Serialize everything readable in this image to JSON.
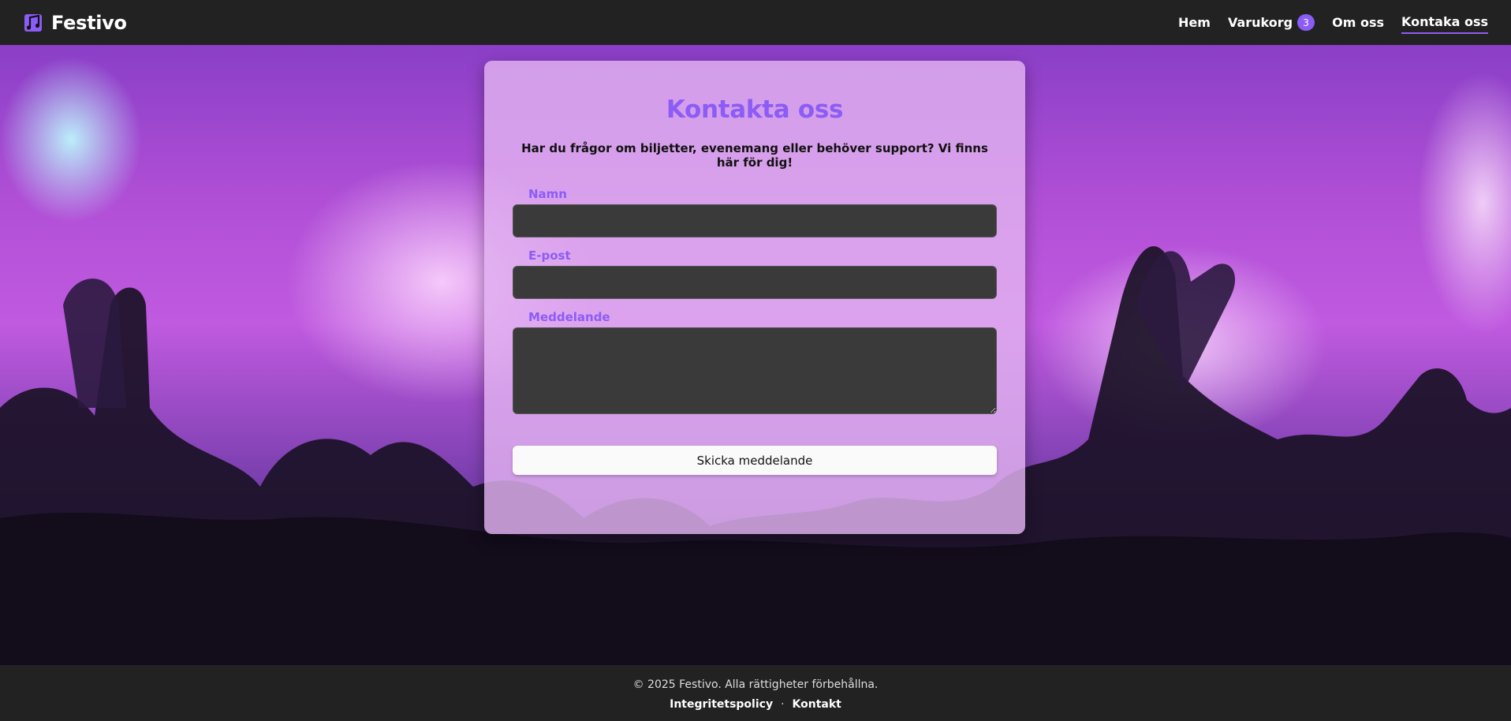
{
  "header": {
    "brand": "Festivo",
    "brand_icon": "music-notes-icon",
    "accent_color": "#8b5cf6",
    "nav": {
      "home": "Hem",
      "cart": "Varukorg",
      "cart_count": "3",
      "about": "Om oss",
      "contact": "Kontaka oss"
    }
  },
  "contact_form": {
    "title": "Kontakta oss",
    "intro": "Har du frågor om biljetter, evenemang eller behöver support? Vi finns här för dig!",
    "name_label": "Namn",
    "name_value": "",
    "email_label": "E-post",
    "email_value": "",
    "message_label": "Meddelande",
    "message_value": "",
    "submit_label": "Skicka meddelande"
  },
  "footer": {
    "copyright": "© 2025 Festivo. Alla rättigheter förbehållna.",
    "privacy": "Integritetspolicy",
    "separator": "·",
    "contact": "Kontakt"
  }
}
